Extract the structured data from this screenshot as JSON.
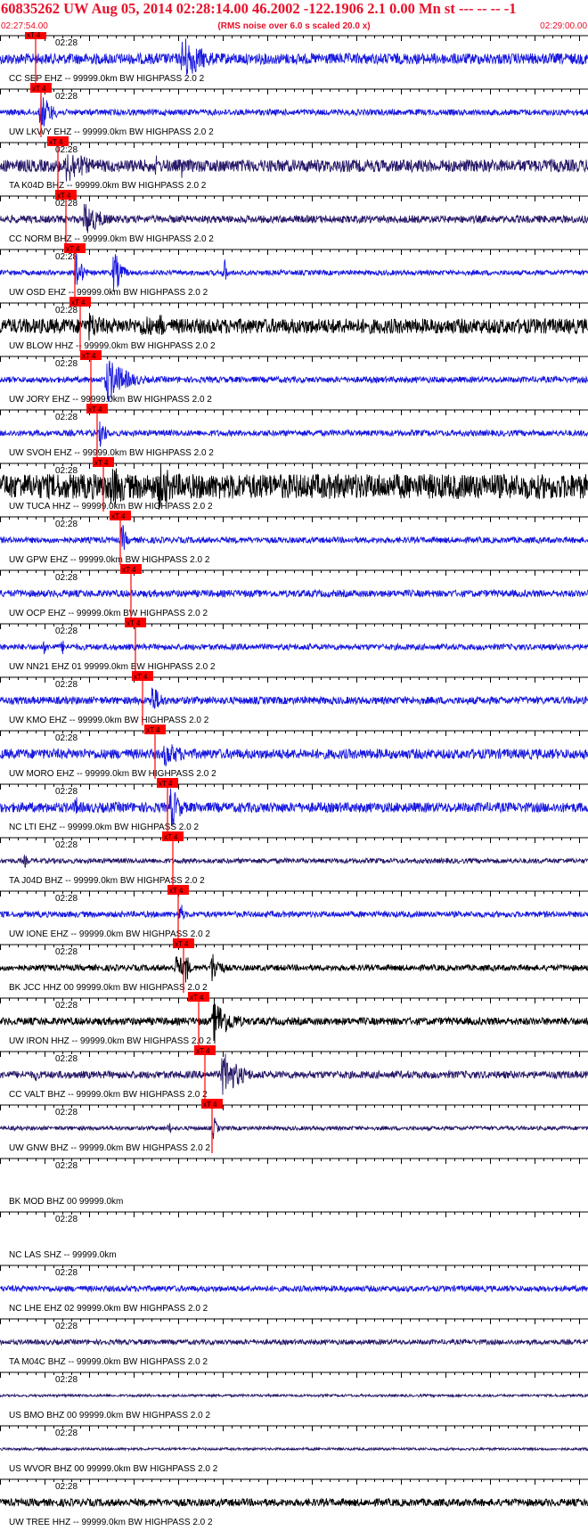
{
  "header": {
    "title": "60835262 UW Aug 05, 2014 02:28:14.00   46.2002 -122.1906  2.1 0.00 Mn st --- -- --  -1",
    "start_time": "02:27:54.00",
    "rms_note": "(RMS noise over 6.0 s scaled 20.0 x)",
    "end_time": "02:29:00.00"
  },
  "colors": {
    "header": "#e8102a",
    "axis": "#000000",
    "pick": "#ff0000",
    "label": "#000000"
  },
  "chart_data": {
    "type": "line",
    "title": "60835262 UW Aug 05, 2014 02:28:14.00   46.2002 -122.1906  2.1 0.00 Mn st --- -- --  -1",
    "x_start": "02:27:54.00",
    "x_end": "02:29:00.00",
    "x_range_seconds": [
      0,
      66
    ],
    "tick_label": "02:28",
    "pick_label": "xT 4",
    "series": [
      {
        "label": "CC SEP EHZ -- 99999.0km BW  HIGHPASS  2.0  2",
        "color": "#1a1ae0",
        "amp": 0.22,
        "pick": 4.0,
        "bursts": [
          {
            "t": 20.5,
            "a": 1.0,
            "w": 2.5
          }
        ]
      },
      {
        "label": "UW LKWY EHZ -- 99999.0km BW  HIGHPASS  2.0  2",
        "color": "#1a1ae0",
        "amp": 0.12,
        "pick": 4.6,
        "bursts": [
          {
            "t": 4.6,
            "a": 0.85,
            "w": 1.2
          }
        ]
      },
      {
        "label": "TA K04D BHZ -- 99999.0km BW  HIGHPASS  2.0  2",
        "color": "#2a1a6a",
        "amp": 0.25,
        "pick": 6.5,
        "bursts": [
          {
            "t": 7.5,
            "a": 0.8,
            "w": 2.5
          },
          {
            "t": 17.5,
            "a": 0.5,
            "w": 0.3
          },
          {
            "t": 20.4,
            "a": 0.6,
            "w": 0.2
          }
        ]
      },
      {
        "label": "CC NORM BHZ -- 99999.0km BW  HIGHPASS  2.0  2",
        "color": "#2a1a6a",
        "amp": 0.15,
        "pick": 7.4,
        "bursts": [
          {
            "t": 9.5,
            "a": 0.75,
            "w": 2.0
          }
        ]
      },
      {
        "label": "UW OSD EHZ -- 99999.0km BW  HIGHPASS  2.0  2",
        "color": "#1a1ae0",
        "amp": 0.1,
        "pick": 8.4,
        "bursts": [
          {
            "t": 8.6,
            "a": 1.0,
            "w": 0.6
          },
          {
            "t": 12.8,
            "a": 1.0,
            "w": 0.8
          },
          {
            "t": 25.2,
            "a": 0.6,
            "w": 0.3
          }
        ]
      },
      {
        "label": "UW BLOW HHZ -- 99999.0km BW  HIGHPASS  2.0  2",
        "color": "#000000",
        "amp": 0.3,
        "pick": 9.0,
        "bursts": [
          {
            "t": 10,
            "a": 0.6,
            "w": 2.5
          },
          {
            "t": 16,
            "a": 0.55,
            "w": 2.0
          },
          {
            "t": 18,
            "a": 0.7,
            "w": 0.4
          }
        ]
      },
      {
        "label": "UW JORY EHZ -- 99999.0km BW  HIGHPASS  2.0  2",
        "color": "#1a1ae0",
        "amp": 0.12,
        "pick": 10.2,
        "bursts": [
          {
            "t": 12,
            "a": 1.0,
            "w": 2.2
          }
        ]
      },
      {
        "label": "UW SVOH EHZ -- 99999.0km BW  HIGHPASS  2.0  2",
        "color": "#1a1ae0",
        "amp": 0.12,
        "pick": 10.9,
        "bursts": [
          {
            "t": 11.3,
            "a": 0.7,
            "w": 0.6
          }
        ]
      },
      {
        "label": "UW TUCA HHZ -- 99999.0km BW  HIGHPASS  2.0  2",
        "color": "#000000",
        "amp": 0.5,
        "pick": 11.6,
        "bursts": [
          {
            "t": 12.5,
            "a": 0.9,
            "w": 3.0
          },
          {
            "t": 17.8,
            "a": 1.0,
            "w": 2.5
          }
        ]
      },
      {
        "label": "UW GPW EHZ -- 99999.0km BW  HIGHPASS  2.0  2",
        "color": "#1a1ae0",
        "amp": 0.12,
        "pick": 13.5,
        "bursts": [
          {
            "t": 13.7,
            "a": 0.75,
            "w": 0.5
          }
        ]
      },
      {
        "label": "UW OCP EHZ -- 99999.0km BW  HIGHPASS  2.0  2",
        "color": "#1a1ae0",
        "amp": 0.14,
        "pick": 14.7,
        "bursts": []
      },
      {
        "label": "UW NN21 EHZ 01 99999.0km BW  HIGHPASS  2.0  2",
        "color": "#1a1ae0",
        "amp": 0.12,
        "pick": 15.2,
        "bursts": [
          {
            "t": 5,
            "a": 0.35,
            "w": 0.4
          },
          {
            "t": 7,
            "a": 0.35,
            "w": 0.4
          }
        ]
      },
      {
        "label": "UW KMO EHZ -- 99999.0km BW  HIGHPASS  2.0  2",
        "color": "#1a1ae0",
        "amp": 0.15,
        "pick": 16.0,
        "bursts": [
          {
            "t": 17,
            "a": 0.7,
            "w": 1.2
          }
        ]
      },
      {
        "label": "UW MORO EHZ -- 99999.0km BW  HIGHPASS  2.0  2",
        "color": "#1a1ae0",
        "amp": 0.2,
        "pick": 17.4,
        "bursts": [
          {
            "t": 18.5,
            "a": 0.55,
            "w": 2.5
          }
        ]
      },
      {
        "label": "NC LTI EHZ -- 99999.0km BW  HIGHPASS  2.0  2",
        "color": "#1a1ae0",
        "amp": 0.2,
        "pick": 18.8,
        "bursts": [
          {
            "t": 19.2,
            "a": 1.0,
            "w": 1.0
          },
          {
            "t": 8.5,
            "a": 0.5,
            "w": 0.6
          }
        ]
      },
      {
        "label": "TA J04D BHZ -- 99999.0km BW  HIGHPASS  2.0  2",
        "color": "#2a1a6a",
        "amp": 0.1,
        "pick": 19.4,
        "bursts": [
          {
            "t": 2.8,
            "a": 0.3,
            "w": 0.4
          }
        ]
      },
      {
        "label": "UW IONE EHZ -- 99999.0km BW  HIGHPASS  2.0  2",
        "color": "#1a1ae0",
        "amp": 0.12,
        "pick": 20.0,
        "bursts": [
          {
            "t": 20.3,
            "a": 0.6,
            "w": 0.3
          }
        ]
      },
      {
        "label": "BK JCC HHZ 00 99999.0km BW  HIGHPASS  2.0  2",
        "color": "#000000",
        "amp": 0.12,
        "pick": 20.6,
        "bursts": [
          {
            "t": 19.8,
            "a": 0.6,
            "w": 1.3
          },
          {
            "t": 20.9,
            "a": 0.9,
            "w": 0.3
          },
          {
            "t": 23.8,
            "a": 0.7,
            "w": 1.0
          }
        ]
      },
      {
        "label": "UW IRON HHZ -- 99999.0km BW  HIGHPASS  2.0  2",
        "color": "#000000",
        "amp": 0.15,
        "pick": 22.3,
        "bursts": [
          {
            "t": 24,
            "a": 0.95,
            "w": 2.0
          }
        ]
      },
      {
        "label": "CC VALT BHZ -- 99999.0km BW  HIGHPASS  2.0  2",
        "color": "#2a1a6a",
        "amp": 0.15,
        "pick": 23.0,
        "bursts": [
          {
            "t": 25,
            "a": 1.0,
            "w": 2.0
          },
          {
            "t": 4,
            "a": 0.3,
            "w": 0.5
          }
        ]
      },
      {
        "label": "UW GNW BHZ -- 99999.0km BW  HIGHPASS  2.0  2",
        "color": "#2a1a6a",
        "amp": 0.08,
        "pick": 23.8,
        "bursts": [
          {
            "t": 24,
            "a": 0.55,
            "w": 0.4
          },
          {
            "t": 19,
            "a": 0.3,
            "w": 0.4
          }
        ]
      },
      {
        "label": "BK MOD BHZ 00 99999.0km",
        "color": "#2a1a6a",
        "amp": 0,
        "pick": null,
        "bursts": []
      },
      {
        "label": "NC LAS SHZ -- 99999.0km",
        "color": "#2a1a6a",
        "amp": 0,
        "pick": null,
        "bursts": []
      },
      {
        "label": "NC LHE EHZ 02 99999.0km BW  HIGHPASS  2.0  2",
        "color": "#1a1ae0",
        "amp": 0.12,
        "pick": null,
        "bursts": []
      },
      {
        "label": "TA M04C BHZ -- 99999.0km BW  HIGHPASS  2.0  2",
        "color": "#2a1a6a",
        "amp": 0.1,
        "pick": null,
        "bursts": []
      },
      {
        "label": "US BMO BHZ 00 99999.0km BW  HIGHPASS  2.0  2",
        "color": "#2a1a6a",
        "amp": 0.05,
        "pick": null,
        "bursts": []
      },
      {
        "label": "US WVOR BHZ 00 99999.0km BW  HIGHPASS  2.0  2",
        "color": "#2a1a6a",
        "amp": 0.05,
        "pick": null,
        "bursts": []
      },
      {
        "label": "UW TREE HHZ -- 99999.0km BW  HIGHPASS  2.0  2",
        "color": "#000000",
        "amp": 0.15,
        "pick": null,
        "bursts": []
      }
    ]
  }
}
